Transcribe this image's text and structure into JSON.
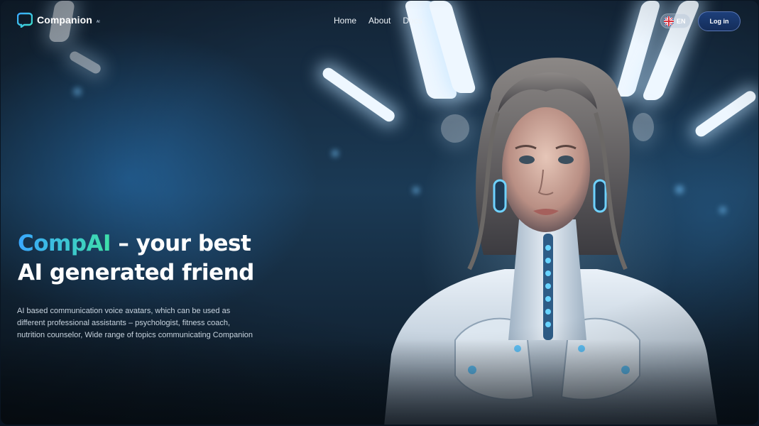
{
  "header": {
    "logo_text": "Companion",
    "logo_sub": "AI",
    "nav": [
      {
        "label": "Home"
      },
      {
        "label": "About"
      },
      {
        "label": "Docs"
      }
    ],
    "language_label": "EN",
    "language_flag": "uk-flag-icon",
    "login_label": "Log in"
  },
  "hero": {
    "title_brand": "CompAI",
    "title_rest_line1": " – your best",
    "title_line2": "AI generated friend",
    "description": "AI based communication voice avatars, which can be used as different professional assistants – psychologist, fitness coach, nutrition counselor, Wide range of topics communicating Companion"
  },
  "colors": {
    "brand_gradient_start": "#3aa8ff",
    "brand_gradient_end": "#3ee0a8",
    "login_bg": "#1d3f7a",
    "background": "#132436"
  }
}
